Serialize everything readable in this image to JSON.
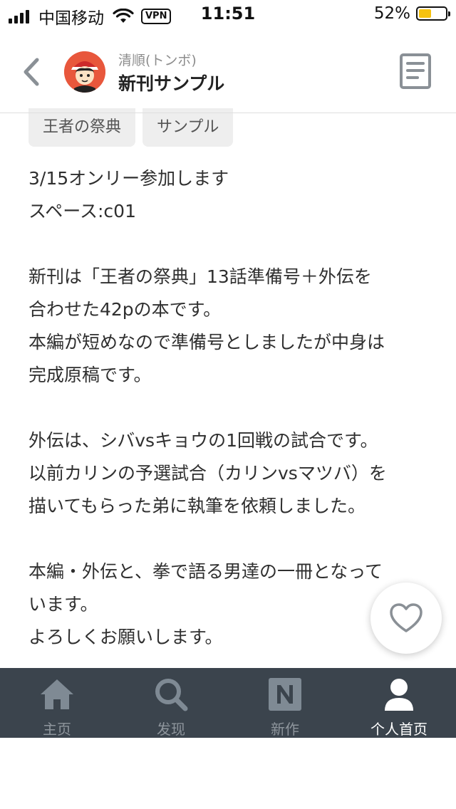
{
  "status_bar": {
    "carrier": "中国移动",
    "vpn": "VPN",
    "time": "11:51",
    "battery": "52%",
    "battery_level": 0.52,
    "battery_color": "#f6c20f"
  },
  "header": {
    "author": "清順(トンボ)",
    "title": "新刊サンプル",
    "back_icon": "chevron-left-icon",
    "doc_icon": "document-icon"
  },
  "tags": [
    "王者の祭典",
    "サンプル"
  ],
  "body": {
    "lines": [
      "3/15オンリー参加します",
      "スペース:c01",
      "",
      "新刊は「王者の祭典」13話準備号＋外伝を",
      "合わせた42pの本です。",
      "本編が短めなので準備号としましたが中身は",
      "完成原稿です。",
      "",
      "外伝は、シバvsキョウの1回戦の試合です。",
      "以前カリンの予選試合（カリンvsマツバ）を",
      "描いてもらった弟に執筆を依頼しました。",
      "",
      "本編・外伝と、拳で語る男達の一冊となって",
      "います。",
      "よろしくお願いします。"
    ]
  },
  "like_button": {
    "icon": "heart-icon"
  },
  "tabbar": {
    "tabs": [
      {
        "label": "主页",
        "icon": "home-icon",
        "active": false
      },
      {
        "label": "发现",
        "icon": "search-icon",
        "active": false
      },
      {
        "label": "新作",
        "icon": "new-work-icon",
        "active": false
      },
      {
        "label": "个人首页",
        "icon": "user-icon",
        "active": true
      }
    ],
    "background": "#3b444d"
  }
}
